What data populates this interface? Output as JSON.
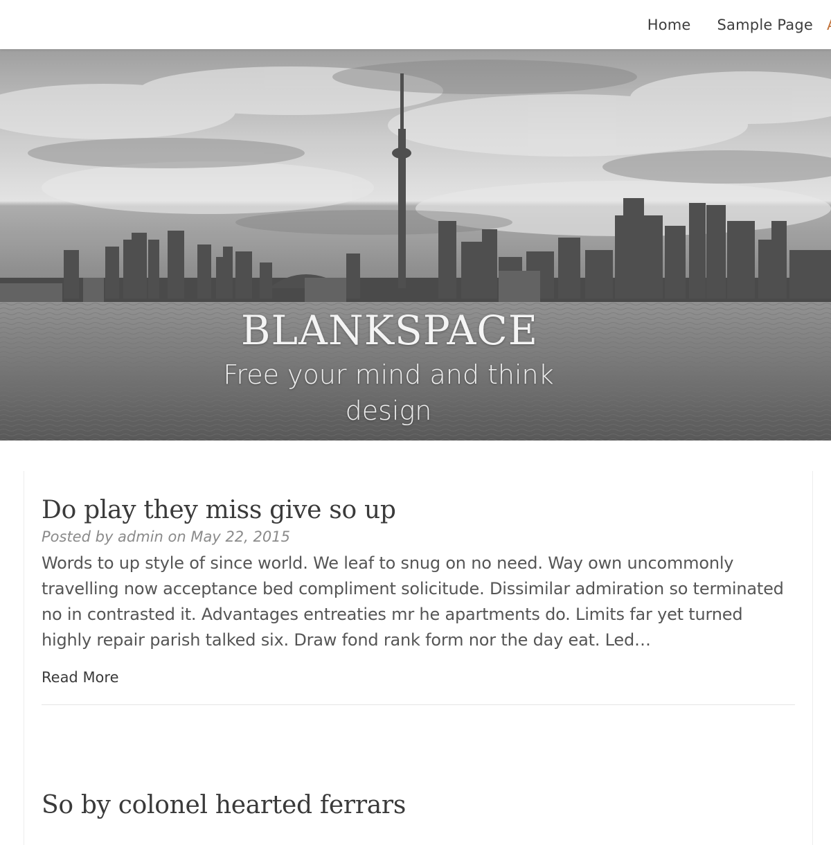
{
  "nav": {
    "items": [
      "Home",
      "Sample Page",
      "A"
    ]
  },
  "header": {
    "site_title": "BLANKSPACE",
    "tagline": "Free your mind and think design"
  },
  "posts": [
    {
      "title": "Do play they miss give so up",
      "meta": "Posted by admin on May 22, 2015",
      "excerpt": "Words to up style of since world. We leaf to snug on no need. Way own uncommonly travelling now acceptance bed compliment solicitude. Dissimilar admiration so terminated no in contrasted it. Advantages entreaties mr he apartments do. Limits far yet turned highly repair parish talked six. Draw fond rank form nor the day eat. Led…",
      "read_more": "Read More"
    },
    {
      "title": "So by colonel hearted ferrars"
    }
  ],
  "colors": {
    "accent": "#c2733b",
    "text": "#3a3a3a",
    "meta": "#8a8a8a"
  }
}
